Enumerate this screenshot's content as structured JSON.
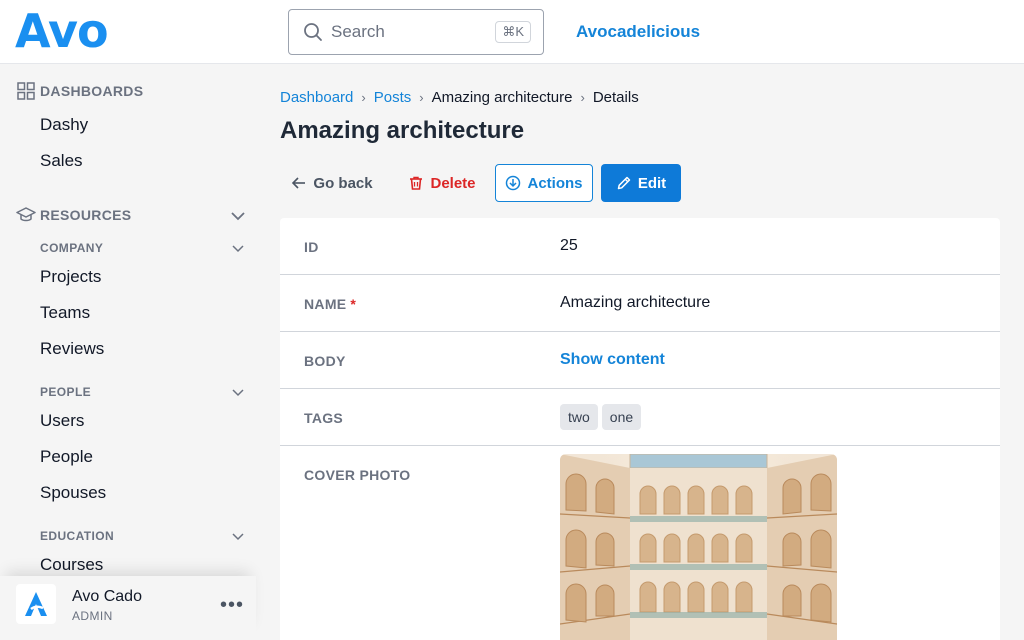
{
  "header": {
    "logo": "Avo",
    "search": {
      "placeholder": "Search",
      "shortcut": "⌘K"
    },
    "app_name": "Avocadelicious"
  },
  "sidebar": {
    "dashboards": {
      "title": "DASHBOARDS",
      "icon": "grid-icon",
      "items": [
        {
          "label": "Dashy"
        },
        {
          "label": "Sales"
        }
      ]
    },
    "resources": {
      "title": "RESOURCES",
      "icon": "graduation-cap-icon",
      "groups": [
        {
          "title": "COMPANY",
          "items": [
            {
              "label": "Projects"
            },
            {
              "label": "Teams"
            },
            {
              "label": "Reviews"
            }
          ]
        },
        {
          "title": "PEOPLE",
          "items": [
            {
              "label": "Users"
            },
            {
              "label": "People"
            },
            {
              "label": "Spouses"
            }
          ]
        },
        {
          "title": "EDUCATION",
          "items": [
            {
              "label": "Courses"
            }
          ]
        }
      ]
    },
    "user": {
      "name": "Avo Cado",
      "role": "ADMIN",
      "menu": "•••"
    }
  },
  "breadcrumb": [
    {
      "label": "Dashboard"
    },
    {
      "label": "Posts"
    },
    {
      "label": "Amazing architecture"
    },
    {
      "label": "Details"
    }
  ],
  "page_title": "Amazing architecture",
  "actions": {
    "back": "Go back",
    "delete": "Delete",
    "actions": "Actions",
    "edit": "Edit"
  },
  "fields": [
    {
      "label": "ID",
      "value": "25"
    },
    {
      "label": "NAME",
      "required": "*",
      "value": "Amazing architecture"
    },
    {
      "label": "BODY",
      "value": "Show content"
    },
    {
      "label": "TAGS",
      "tags": [
        "two",
        "one"
      ]
    },
    {
      "label": "COVER PHOTO"
    }
  ],
  "colors": {
    "brand": "#1a8ff0",
    "link": "#1484d8",
    "primary_button": "#0e7ad8",
    "danger": "#dc2626"
  }
}
